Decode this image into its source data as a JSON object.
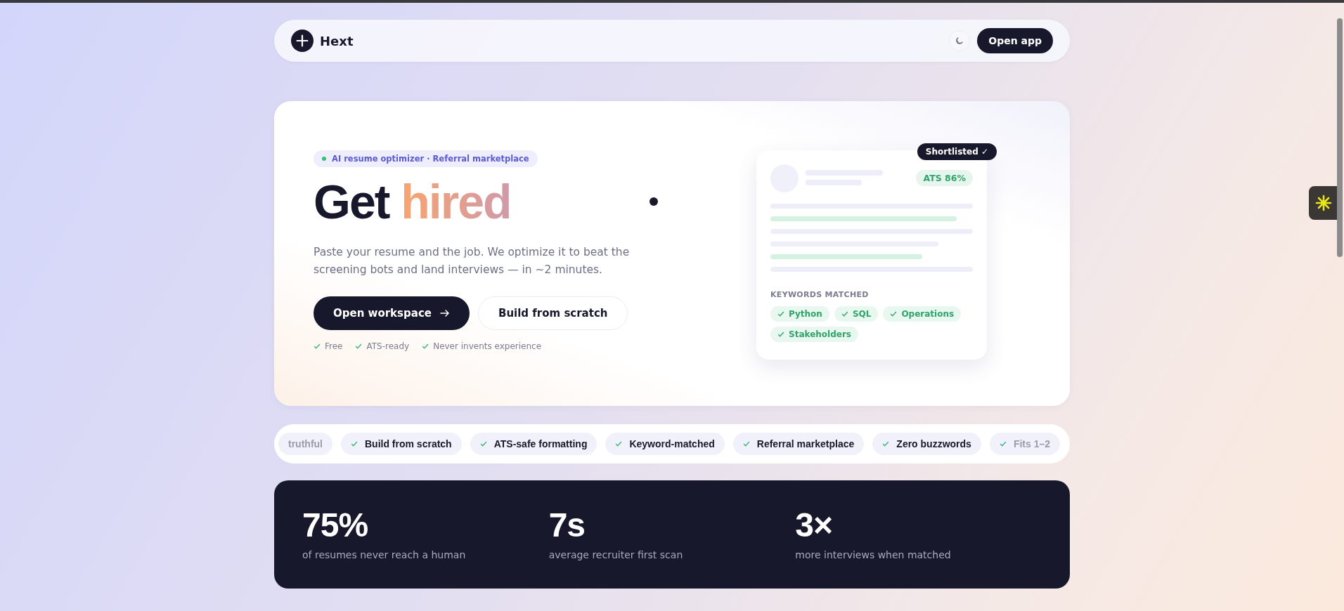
{
  "nav": {
    "brand": "Hext",
    "cta": "Open app"
  },
  "hero": {
    "eyebrow": "AI resume optimizer · Referral marketplace",
    "title_plain": "Get",
    "title_accent": "hired",
    "lead": "Paste your resume and the job. We optimize it to beat the screening bots and land interviews — in ~2 minutes.",
    "primary": "Open workspace",
    "secondary": "Build from scratch",
    "perks": [
      "Free",
      "ATS-ready",
      "Never invents experience"
    ]
  },
  "preview": {
    "badge": "Shortlisted ✓",
    "score": "ATS 86%",
    "keywords_title": "KEYWORDS MATCHED",
    "keywords": [
      "Python",
      "SQL",
      "Operations",
      "Stakeholders"
    ]
  },
  "features": [
    {
      "label": "truthful",
      "check": false
    },
    {
      "label": "Build from scratch",
      "check": true
    },
    {
      "label": "ATS-safe formatting",
      "check": true
    },
    {
      "label": "Keyword-matched",
      "check": true
    },
    {
      "label": "Referral marketplace",
      "check": true
    },
    {
      "label": "Zero buzzwords",
      "check": true
    },
    {
      "label": "Fits 1–2",
      "check": true
    }
  ],
  "stats": [
    {
      "value": "75%",
      "caption": "of resumes never reach a human"
    },
    {
      "value": "7s",
      "caption": "average recruiter first scan"
    },
    {
      "value": "3×",
      "caption": "more interviews when matched"
    }
  ]
}
